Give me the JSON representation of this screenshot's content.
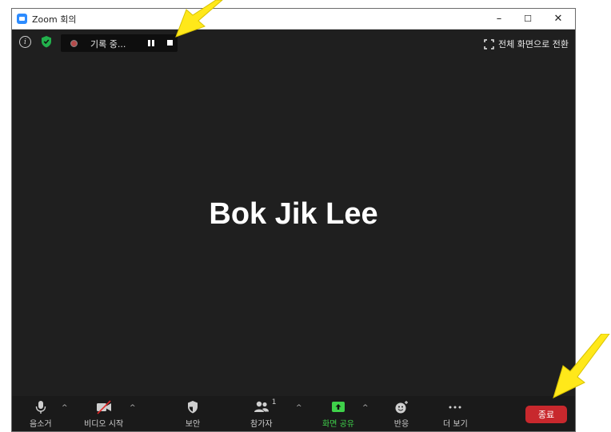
{
  "window": {
    "title": "Zoom 회의"
  },
  "controls": {
    "minimize": "–",
    "maximize": "☐",
    "close": "✕"
  },
  "recording": {
    "status": "기록 중..."
  },
  "fullscreen_label": "전체 화면으로 전환",
  "participant_name": "Bok Jik Lee",
  "toolbar": {
    "mute": "음소거",
    "video": "비디오 시작",
    "security": "보안",
    "participants": "참가자",
    "participants_count": "1",
    "share": "화면 공유",
    "reactions": "반응",
    "more": "더 보기",
    "end": "종료"
  },
  "colors": {
    "background": "#1f1f1f",
    "toolbar": "#1a1a1a",
    "share_green": "#3fd14a",
    "end_red": "#c8282d",
    "zoom_blue": "#2d8cff",
    "annotation_yellow": "#ffe81a"
  }
}
